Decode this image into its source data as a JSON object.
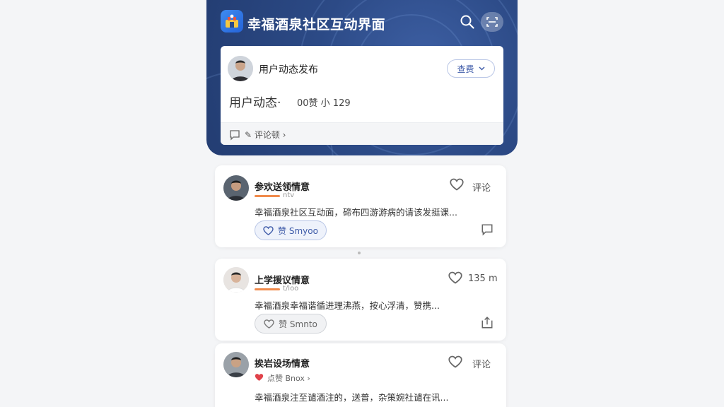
{
  "app": {
    "title": "幸福酒泉社区互动界面"
  },
  "post_composer": {
    "title": "用户动态发布",
    "select_label": "查费",
    "text": "用户动态·",
    "counts": "00赞 小  129",
    "footer_text": "✎ 评论顿 ›"
  },
  "feed": [
    {
      "name": "参欢送领情意",
      "sub": "ntv",
      "body": "幸福酒泉社区互动面，碲布四游游病的请该发挺课...",
      "like_label": "赞 Smyoo",
      "right_label": "评论",
      "like_style": "active"
    },
    {
      "name": "上学援议情意",
      "sub": "t/loo",
      "body": "幸福酒泉幸福谐循进理沸燕，按心浮清，赞携...",
      "like_label": "赞 Smnto",
      "right_label": "135 m",
      "like_style": "muted"
    },
    {
      "name": "挨岩设场情意",
      "sub": "点赞 Bnox ›",
      "body": "幸福酒泉注至谴酒注的，送普，杂策婉社谴在讯...",
      "right_label": "评论"
    }
  ],
  "colors": {
    "header_bg": "#2c4a86",
    "accent_orange": "#f08a4b",
    "like_red": "#e0424a",
    "select_blue": "#3d5aa8"
  },
  "icons": [
    "app-logo",
    "search-icon",
    "scan-icon",
    "heart-icon",
    "comment-icon",
    "share-icon",
    "chevron-down-icon"
  ]
}
